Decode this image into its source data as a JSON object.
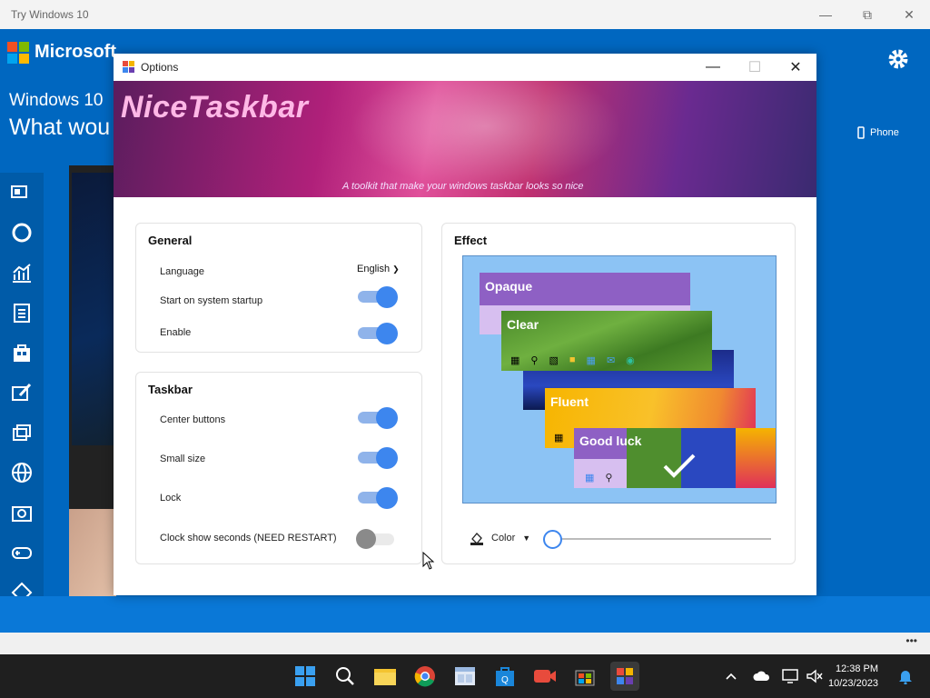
{
  "outer_window": {
    "title": "Try Windows 10"
  },
  "background": {
    "brand": "Microsoft",
    "line1": "Windows 10",
    "line2": "What wou",
    "phone_label": "Phone"
  },
  "dialog": {
    "title": "Options",
    "banner": {
      "brand": "NiceTaskbar",
      "tagline": "A toolkit that make your windows taskbar looks so nice"
    },
    "general": {
      "heading": "General",
      "language_label": "Language",
      "language_value": "English",
      "startup_label": "Start on system startup",
      "startup_on": true,
      "enable_label": "Enable",
      "enable_on": true
    },
    "taskbar": {
      "heading": "Taskbar",
      "center_label": "Center buttons",
      "center_on": true,
      "small_label": "Small size",
      "small_on": true,
      "lock_label": "Lock",
      "lock_on": true,
      "seconds_label": "Clock show seconds (NEED RESTART)",
      "seconds_on": false
    },
    "effect": {
      "heading": "Effect",
      "styles": [
        "Opaque",
        "Clear",
        "Fluent",
        "Good luck"
      ],
      "color_label": "Color",
      "slider_value": 0
    }
  },
  "system_tray": {
    "time": "12:38 PM",
    "date": "10/23/2023"
  },
  "colors": {
    "accent": "#3d86ee",
    "window_blue": "#0067c0",
    "taskbar": "#1f1f1f"
  }
}
